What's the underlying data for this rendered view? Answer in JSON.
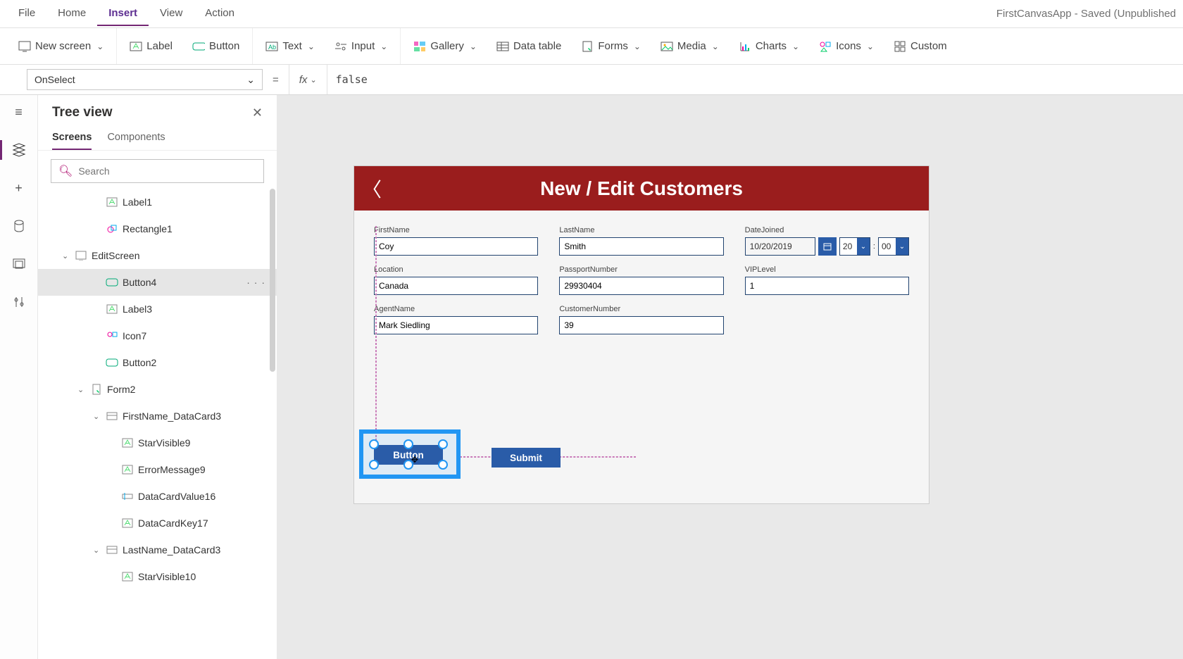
{
  "menubar": {
    "items": [
      "File",
      "Home",
      "Insert",
      "View",
      "Action"
    ],
    "active_index": 2,
    "app_title": "FirstCanvasApp - Saved (Unpublished"
  },
  "ribbon": {
    "new_screen": "New screen",
    "label": "Label",
    "button": "Button",
    "text": "Text",
    "input": "Input",
    "gallery": "Gallery",
    "data_table": "Data table",
    "forms": "Forms",
    "media": "Media",
    "charts": "Charts",
    "icons": "Icons",
    "custom": "Custom"
  },
  "formula": {
    "property": "OnSelect",
    "fx": "fx",
    "value": "false"
  },
  "treepanel": {
    "title": "Tree view",
    "tabs": [
      "Screens",
      "Components"
    ],
    "search_placeholder": "Search",
    "nodes": [
      {
        "label": "Label1",
        "indent": 3,
        "icon": "label"
      },
      {
        "label": "Rectangle1",
        "indent": 3,
        "icon": "shape"
      },
      {
        "label": "EditScreen",
        "indent": 1,
        "icon": "screen",
        "twist": "open"
      },
      {
        "label": "Button4",
        "indent": 3,
        "icon": "button",
        "selected": true,
        "more": "· · ·"
      },
      {
        "label": "Label3",
        "indent": 3,
        "icon": "label"
      },
      {
        "label": "Icon7",
        "indent": 3,
        "icon": "icons"
      },
      {
        "label": "Button2",
        "indent": 3,
        "icon": "button"
      },
      {
        "label": "Form2",
        "indent": 2,
        "icon": "form",
        "twist": "open"
      },
      {
        "label": "FirstName_DataCard3",
        "indent": 3,
        "icon": "card",
        "twist": "open"
      },
      {
        "label": "StarVisible9",
        "indent": 4,
        "icon": "label"
      },
      {
        "label": "ErrorMessage9",
        "indent": 4,
        "icon": "label"
      },
      {
        "label": "DataCardValue16",
        "indent": 4,
        "icon": "input"
      },
      {
        "label": "DataCardKey17",
        "indent": 4,
        "icon": "label"
      },
      {
        "label": "LastName_DataCard3",
        "indent": 3,
        "icon": "card",
        "twist": "open"
      },
      {
        "label": "StarVisible10",
        "indent": 4,
        "icon": "label"
      }
    ]
  },
  "app": {
    "header": "New / Edit Customers",
    "fields": {
      "FirstName": {
        "label": "FirstName",
        "value": "Coy"
      },
      "LastName": {
        "label": "LastName",
        "value": "Smith"
      },
      "DateJoined": {
        "label": "DateJoined",
        "date": "10/20/2019",
        "hour": "20",
        "minute": "00"
      },
      "Location": {
        "label": "Location",
        "value": "Canada"
      },
      "PassportNumber": {
        "label": "PassportNumber",
        "value": "29930404"
      },
      "VIPLevel": {
        "label": "VIPLevel",
        "value": "1"
      },
      "AgentName": {
        "label": "AgentName",
        "value": "Mark Siedling"
      },
      "CustomerNumber": {
        "label": "CustomerNumber",
        "value": "39"
      }
    },
    "selected_button": "Button",
    "submit_button": "Submit"
  }
}
